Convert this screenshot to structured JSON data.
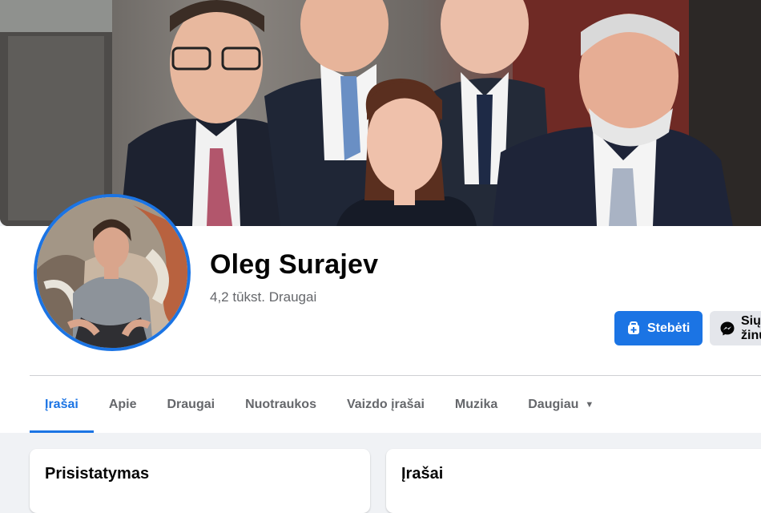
{
  "profile": {
    "name": "Oleg Surajev",
    "friends": "4,2 tūkst. Draugai"
  },
  "actions": {
    "follow_label": "Stebėti",
    "message_label": "Siųsti žinutę",
    "follow_icon": "follow-plus-icon",
    "message_icon": "messenger-icon"
  },
  "tabs": [
    {
      "label": "Įrašai",
      "active": true
    },
    {
      "label": "Apie"
    },
    {
      "label": "Draugai"
    },
    {
      "label": "Nuotraukos"
    },
    {
      "label": "Vaizdo įrašai"
    },
    {
      "label": "Muzika"
    },
    {
      "label": "Daugiau",
      "icon": "caret-down-icon"
    }
  ],
  "cards": {
    "intro_title": "Prisistatymas",
    "posts_title": "Įrašai"
  },
  "colors": {
    "accent": "#1b74e4",
    "secondary_button": "#e4e6eb",
    "muted_text": "#65676b",
    "page_background": "#f0f2f5"
  }
}
